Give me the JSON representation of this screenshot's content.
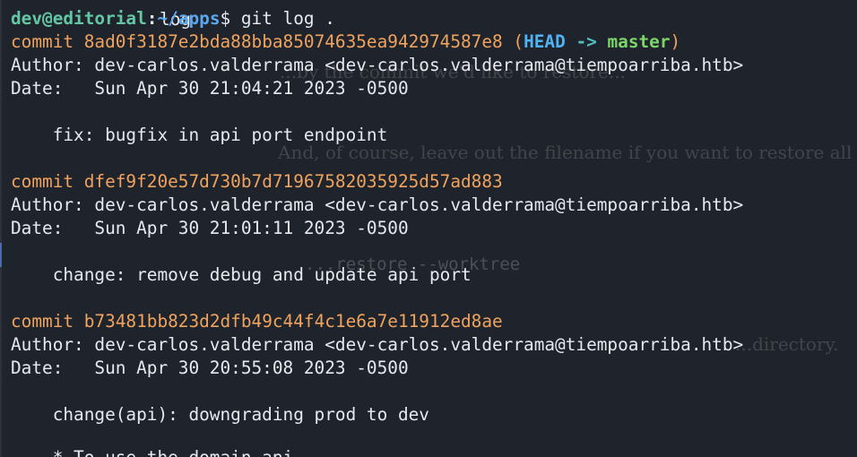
{
  "terminal": {
    "top_partial": "log",
    "prompt": {
      "user_host": "dev@editorial",
      "separator": ":",
      "path": "~/apps",
      "dollar": "$",
      "command": " git log ."
    },
    "commits": [
      {
        "commit_label": "commit",
        "hash": "8ad0f3187e2bda88bba85074635ea942974587e8",
        "refs": {
          "open": " (",
          "head": "HEAD",
          "arrow": " -> ",
          "branch": "master",
          "close": ")"
        },
        "author_line": "Author: dev-carlos.valderrama <dev-carlos.valderrama@tiempoarriba.htb>",
        "date_line": "Date:   Sun Apr 30 21:04:21 2023 -0500",
        "message": "    fix: bugfix in api port endpoint"
      },
      {
        "commit_label": "commit",
        "hash": "dfef9f20e57d730b7d71967582035925d57ad883",
        "author_line": "Author: dev-carlos.valderrama <dev-carlos.valderrama@tiempoarriba.htb>",
        "date_line": "Date:   Sun Apr 30 21:01:11 2023 -0500",
        "message": "    change: remove debug and update api port"
      },
      {
        "commit_label": "commit",
        "hash": "b73481bb823d2dfb49c44f4c1e6a7e11912ed8ae",
        "author_line": "Author: dev-carlos.valderrama <dev-carlos.valderrama@tiempoarriba.htb>",
        "date_line": "Date:   Sun Apr 30 20:55:08 2023 -0500",
        "message": "    change(api): downgrading prod to dev"
      }
    ],
    "bottom_partial": "    * To use the domain api ..."
  },
  "background_overlay": {
    "line1": "...by the commit we'd like to restore...",
    "line2": "And, of course, leave out the filename if you want to restore all files in the",
    "line3": "...restore --worktree",
    "line4": "...directory."
  },
  "colors": {
    "background": "#1f232b",
    "text": "#e6e9ef",
    "prompt_user": "#63c7a4",
    "prompt_path": "#5aa8f0",
    "commit_hash": "#f0a35e",
    "head_ref": "#4fb2f2",
    "branch_ref": "#7bd66a"
  }
}
